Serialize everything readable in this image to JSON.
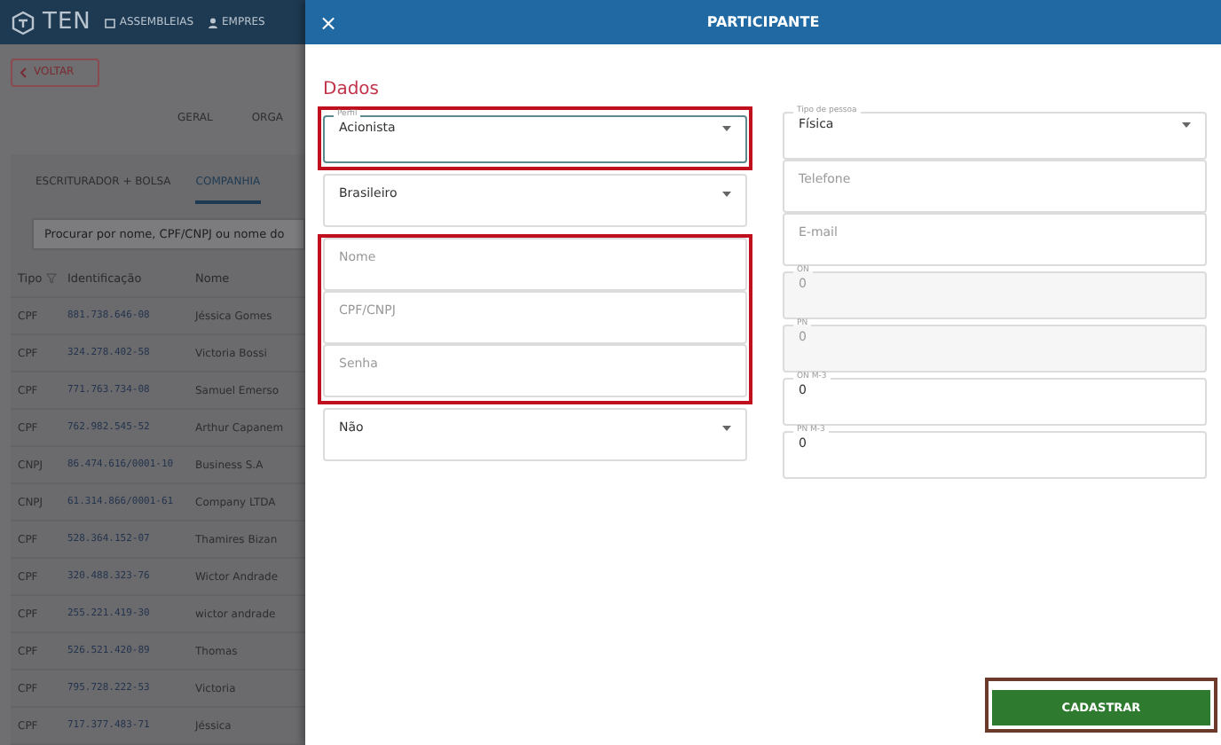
{
  "topbar": {
    "logo": "TEN",
    "nav": [
      "ASSEMBLEIAS",
      "EMPRES"
    ]
  },
  "back_button": "VOLTAR",
  "page_tabs": [
    {
      "label": "GERAL",
      "selected": false
    },
    {
      "label": "ORGA",
      "selected": false
    }
  ],
  "sub_tabs": [
    {
      "label": "ESCRITURADOR + BOLSA",
      "selected": false
    },
    {
      "label": "COMPANHIA",
      "selected": true
    }
  ],
  "search": {
    "placeholder": "Procurar por nome, CPF/CNPJ ou nome do"
  },
  "table": {
    "columns": [
      "Tipo",
      "Identificação",
      "Nome"
    ],
    "rows": [
      [
        "CPF",
        "881.738.646-08",
        "Jéssica Gomes"
      ],
      [
        "CPF",
        "324.278.402-58",
        "Victoria Bossi"
      ],
      [
        "CPF",
        "771.763.734-08",
        "Samuel Emerso"
      ],
      [
        "CPF",
        "762.982.545-52",
        "Arthur Capanem"
      ],
      [
        "CNPJ",
        "86.474.616/0001-10",
        "Business S.A"
      ],
      [
        "CNPJ",
        "61.314.866/0001-61",
        "Company LTDA"
      ],
      [
        "CPF",
        "528.364.152-07",
        "Thamires Bizan"
      ],
      [
        "CPF",
        "320.488.323-76",
        "Wictor Andrade"
      ],
      [
        "CPF",
        "255.221.419-30",
        "wictor andrade"
      ],
      [
        "CPF",
        "526.521.420-89",
        "Thomas"
      ],
      [
        "CPF",
        "795.728.222-53",
        "Victoria"
      ],
      [
        "CPF",
        "717.377.483-71",
        "Jéssica"
      ]
    ]
  },
  "drawer": {
    "close": "×",
    "title": "PARTICIPANTE",
    "section": "Dados",
    "left_groups": [
      {
        "highlighted": true,
        "fields": [
          {
            "kind": "select",
            "label": "Perfil",
            "value": "Acionista",
            "focused": true
          }
        ]
      },
      {
        "highlighted": false,
        "fields": [
          {
            "kind": "select",
            "value": "Brasileiro",
            "focused": false
          }
        ]
      },
      {
        "highlighted": true,
        "fields": [
          {
            "kind": "input",
            "placeholder": "Nome",
            "focused": false
          },
          {
            "kind": "input",
            "placeholder": "CPF/CNPJ",
            "focused": false
          },
          {
            "kind": "input",
            "placeholder": "Senha",
            "focused": false
          }
        ]
      },
      {
        "highlighted": false,
        "fields": [
          {
            "kind": "select",
            "value": "Não",
            "focused": false
          }
        ]
      }
    ],
    "right_fields": [
      {
        "kind": "select",
        "label": "Tipo de pessoa",
        "value": "Física",
        "disabled": false
      },
      {
        "kind": "input",
        "placeholder": "Telefone",
        "disabled": false
      },
      {
        "kind": "input",
        "placeholder": "E-mail",
        "disabled": false
      },
      {
        "kind": "input",
        "label": "ON",
        "value": "0",
        "disabled": true
      },
      {
        "kind": "input",
        "label": "PN",
        "value": "0",
        "disabled": true
      },
      {
        "kind": "input",
        "label": "ON M-3",
        "value": "0",
        "disabled": false
      },
      {
        "kind": "input",
        "label": "PN M-3",
        "value": "0",
        "disabled": false
      }
    ],
    "submit": {
      "label": "CADASTRAR",
      "highlighted": true
    }
  }
}
